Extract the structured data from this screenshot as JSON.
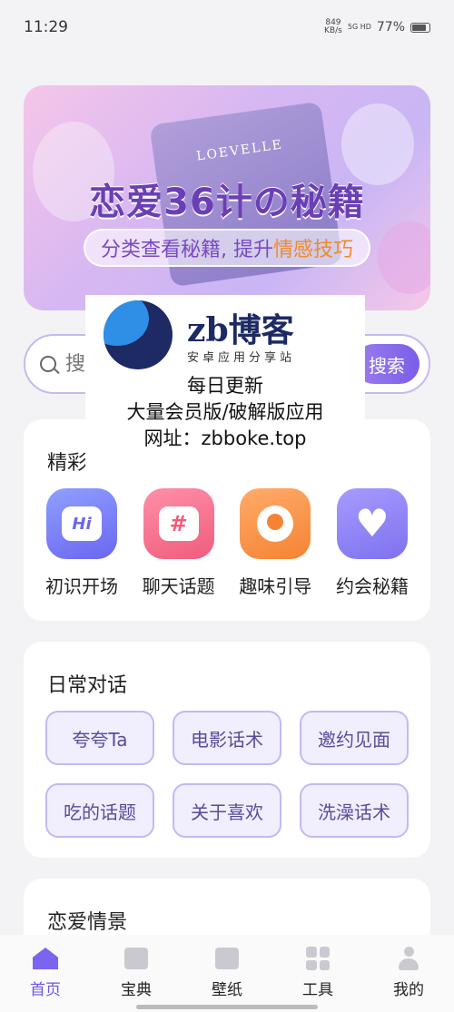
{
  "status": {
    "time": "11:29",
    "net_speed_value": "849",
    "net_speed_unit": "KB/s",
    "signal": "5G HD",
    "battery": "77%",
    "battery_level": 0.77
  },
  "banner": {
    "title": "恋爱36计の秘籍",
    "subtitle_main": "分类查看秘籍, 提升",
    "subtitle_highlight": "情感技巧",
    "book_label": "LOEVELLE"
  },
  "search": {
    "placeholder": "搜",
    "button_label": "搜索"
  },
  "featured": {
    "title": "精彩",
    "items": [
      {
        "label": "初识开场",
        "glyph": "Hi"
      },
      {
        "label": "聊天话题",
        "glyph": "#"
      },
      {
        "label": "趣味引导",
        "glyph": ""
      },
      {
        "label": "约会秘籍",
        "glyph": "♥"
      }
    ]
  },
  "daily": {
    "title": "日常对话",
    "tags": [
      "夸夸Ta",
      "电影话术",
      "邀约见面",
      "吃的话题",
      "关于喜欢",
      "洗澡话术"
    ]
  },
  "scenes": {
    "title": "恋爱情景"
  },
  "watermark": {
    "brand": "zb博客",
    "sub": "安卓应用分享站",
    "line1": "每日更新",
    "line2": "大量会员版/破解版应用",
    "line3": "网址：zbboke.top"
  },
  "tabbar": {
    "items": [
      "首页",
      "宝典",
      "壁纸",
      "工具",
      "我的"
    ]
  },
  "colors": {
    "accent": "#7a5ee8",
    "tag_bg": "#f1eefe",
    "highlight": "#f08a2a"
  }
}
